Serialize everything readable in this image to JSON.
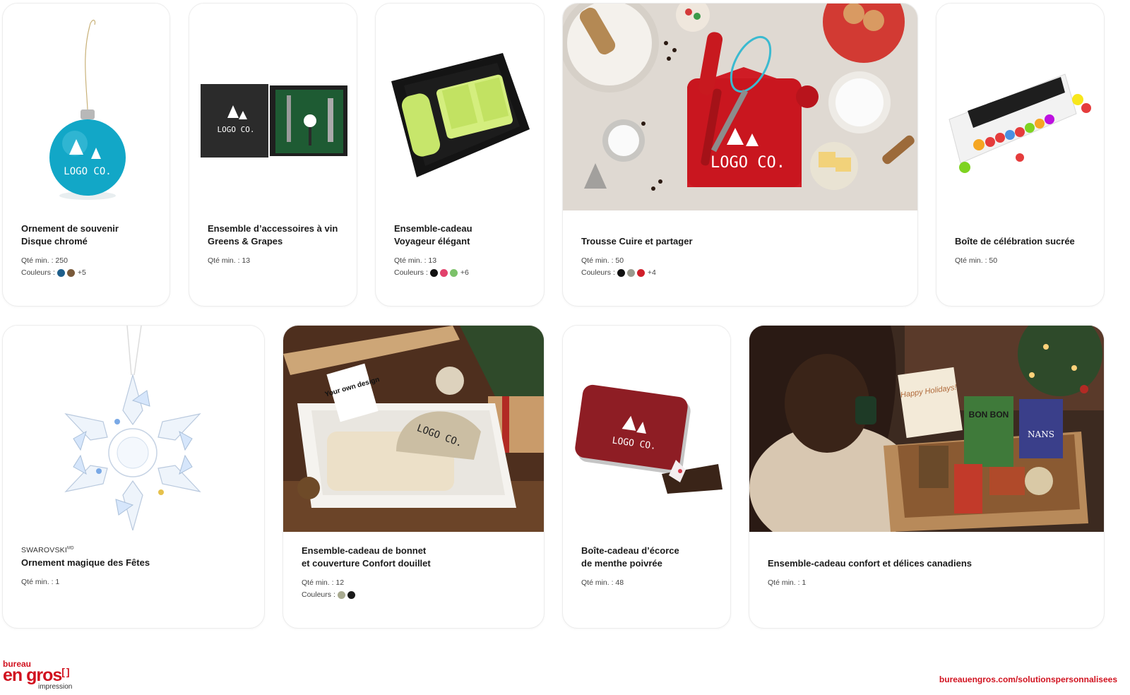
{
  "colors": {
    "brand_red": "#d1121f",
    "background": "#ffffff",
    "card_border": "#ececec"
  },
  "cards": [
    {
      "brand": "",
      "title": "Ornement de souvenir\nDisque chromé",
      "qty": "Qté min. : 250",
      "colors_label": "Couleurs :",
      "swatches": [
        "#1f5f8b",
        "#7a5a3a"
      ],
      "more": "+5",
      "image_icon": "blue-ornament-image"
    },
    {
      "brand": "",
      "title": "Ensemble d’accessoires à vin\nGreens & Grapes",
      "qty": "Qté min. : 13",
      "colors_label": "",
      "swatches": [],
      "more": "",
      "image_icon": "wine-accessory-set-image"
    },
    {
      "brand": "",
      "title": "Ensemble-cadeau\nVoyageur élégant",
      "qty": "Qté min. : 13",
      "colors_label": "Couleurs :",
      "swatches": [
        "#111111",
        "#e2416b",
        "#7cc26a"
      ],
      "more": "+6",
      "image_icon": "travel-gift-set-image"
    },
    {
      "brand": "",
      "title": "Trousse Cuire et partager",
      "qty": "Qté min. : 50",
      "colors_label": "Couleurs :",
      "swatches": [
        "#111111",
        "#9a9a8e",
        "#d01f2a"
      ],
      "more": "+4",
      "image_icon": "baking-kit-image"
    },
    {
      "brand": "",
      "title": "Boîte de célébration sucrée",
      "qty": "Qté min. : 50",
      "colors_label": "",
      "swatches": [],
      "more": "",
      "image_icon": "candy-box-image"
    },
    {
      "brand": "SWAROVSKI",
      "brand_mark": "MD",
      "title": "Ornement magique des Fêtes",
      "qty": "Qté min. : 1",
      "colors_label": "",
      "swatches": [],
      "more": "",
      "image_icon": "crystal-snowflake-image"
    },
    {
      "brand": "",
      "title": "Ensemble-cadeau de bonnet\net couverture Confort douillet",
      "qty": "Qté min. : 12",
      "colors_label": "Couleurs :",
      "swatches": [
        "#a8aa90",
        "#1a1a1a"
      ],
      "more": "",
      "image_icon": "beanie-blanket-box-image"
    },
    {
      "brand": "",
      "title": "Boîte-cadeau d’écorce\nde menthe poivrée",
      "qty": "Qté min. : 48",
      "colors_label": "",
      "swatches": [],
      "more": "",
      "image_icon": "peppermint-bark-tin-image"
    },
    {
      "brand": "",
      "title": "Ensemble-cadeau confort et délices canadiens",
      "qty": "Qté min. : 1",
      "colors_label": "",
      "swatches": [],
      "more": "",
      "image_icon": "canadian-treats-box-image"
    }
  ],
  "image_text": {
    "logo_co": "LOGO CO.",
    "your_own_design": "Your own design",
    "happy_holidays": "Happy Holidays!",
    "bon_bon": "BON BON",
    "nans": "NANS"
  },
  "footer": {
    "logo_line1": "bureau",
    "logo_line2": "en gros",
    "logo_bracket": "[ ]",
    "logo_line3": "impression",
    "url": "bureauengros.com/solutionspersonnalisees"
  }
}
